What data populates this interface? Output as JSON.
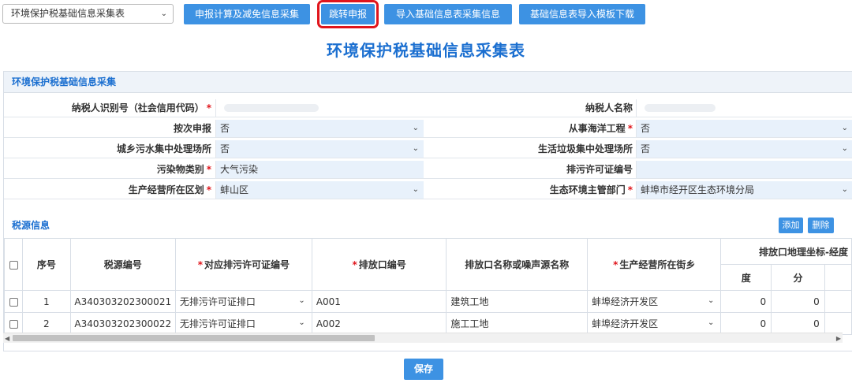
{
  "toolbar": {
    "form_select": "环境保护税基础信息采集表",
    "buttons": [
      "申报计算及减免信息采集",
      "跳转申报",
      "导入基础信息表采集信息",
      "基础信息表导入模板下载"
    ]
  },
  "page_title": "环境保护税基础信息采集表",
  "basic": {
    "heading": "环境保护税基础信息采集",
    "fields": {
      "taxpayer_id_label": "纳税人识别号（社会信用代码）",
      "taxpayer_name_label": "纳税人名称",
      "per_time_label": "按次申报",
      "per_time_value": "否",
      "marine_label": "从事海洋工程",
      "marine_value": "否",
      "sewage_label": "城乡污水集中处理场所",
      "sewage_value": "否",
      "garbage_label": "生活垃圾集中处理场所",
      "garbage_value": "否",
      "pollutant_label": "污染物类别",
      "pollutant_value": "大气污染",
      "permit_label": "排污许可证编号",
      "permit_value": "",
      "district_label": "生产经营所在区划",
      "district_value": "蚌山区",
      "env_dept_label": "生态环境主管部门",
      "env_dept_value": "蚌埠市经开区生态环境分局"
    }
  },
  "tax_source": {
    "heading": "税源信息",
    "add_label": "添加",
    "delete_label": "删除",
    "columns": {
      "seq": "序号",
      "code": "税源编号",
      "permit": "对应排污许可证编号",
      "outlet": "排放口编号",
      "outlet_name": "排放口名称或噪声源名称",
      "street": "生产经营所在街乡",
      "coord": "排放口地理坐标-经度",
      "deg": "度",
      "min": "分"
    },
    "rows": [
      {
        "seq": "1",
        "code": "A340303202300021",
        "permit": "无排污许可证排口",
        "outlet": "A001",
        "outlet_name": "建筑工地",
        "street": "蚌埠经济开发区",
        "deg": "0",
        "min": "0"
      },
      {
        "seq": "2",
        "code": "A340303202300022",
        "permit": "无排污许可证排口",
        "outlet": "A002",
        "outlet_name": "施工工地",
        "street": "蚌埠经济开发区",
        "deg": "0",
        "min": "0"
      }
    ]
  },
  "save_label": "保存"
}
